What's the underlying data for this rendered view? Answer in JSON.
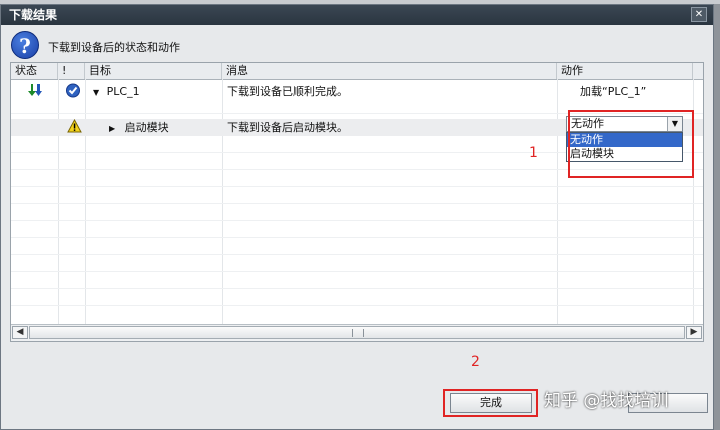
{
  "window": {
    "title": "下载结果"
  },
  "header": {
    "text": "下载到设备后的状态和动作"
  },
  "columns": [
    "状态",
    "!",
    "目标",
    "消息",
    "动作"
  ],
  "rows": [
    {
      "target": "PLC_1",
      "message": "下载到设备已顺利完成。",
      "action": "加载“PLC_1”"
    },
    {
      "target": "启动模块",
      "message": "下载到设备后启动模块。",
      "action": "无动作"
    }
  ],
  "dropdown": {
    "selected": "无动作",
    "options": [
      "无动作",
      "启动模块"
    ]
  },
  "annotations": {
    "mark1": "1",
    "mark2": "2",
    "color": "#e02424"
  },
  "buttons": {
    "finish": "完成"
  },
  "watermark": "知乎 @找找培训"
}
